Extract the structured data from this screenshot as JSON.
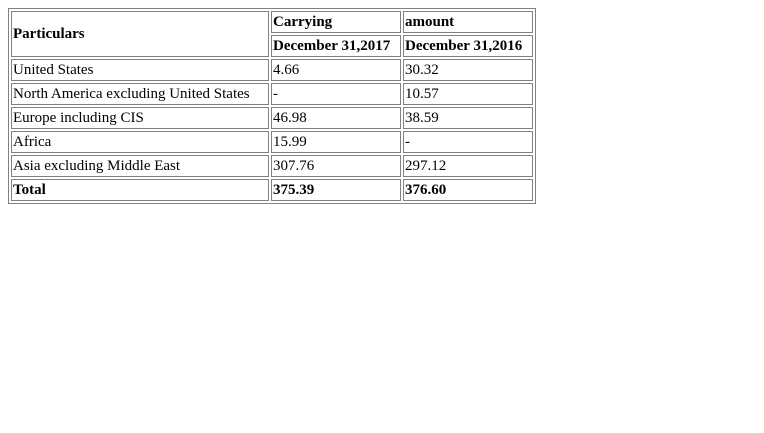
{
  "table": {
    "header": {
      "particulars": "Particulars",
      "group_left": "Carrying",
      "group_right": "amount",
      "col_2017": "December 31,2017",
      "col_2016": "December 31,2016"
    },
    "rows": [
      {
        "label": "United States",
        "v2017": "4.66",
        "v2016": "30.32"
      },
      {
        "label": "North America excluding United States",
        "v2017": "-",
        "v2016": "10.57"
      },
      {
        "label": "Europe including CIS",
        "v2017": "46.98",
        "v2016": "38.59"
      },
      {
        "label": "Africa",
        "v2017": "15.99",
        "v2016": "-"
      },
      {
        "label": "Asia excluding Middle East",
        "v2017": "307.76",
        "v2016": "297.12"
      }
    ],
    "total": {
      "label": "Total",
      "v2017": "375.39",
      "v2016": "376.60"
    }
  }
}
